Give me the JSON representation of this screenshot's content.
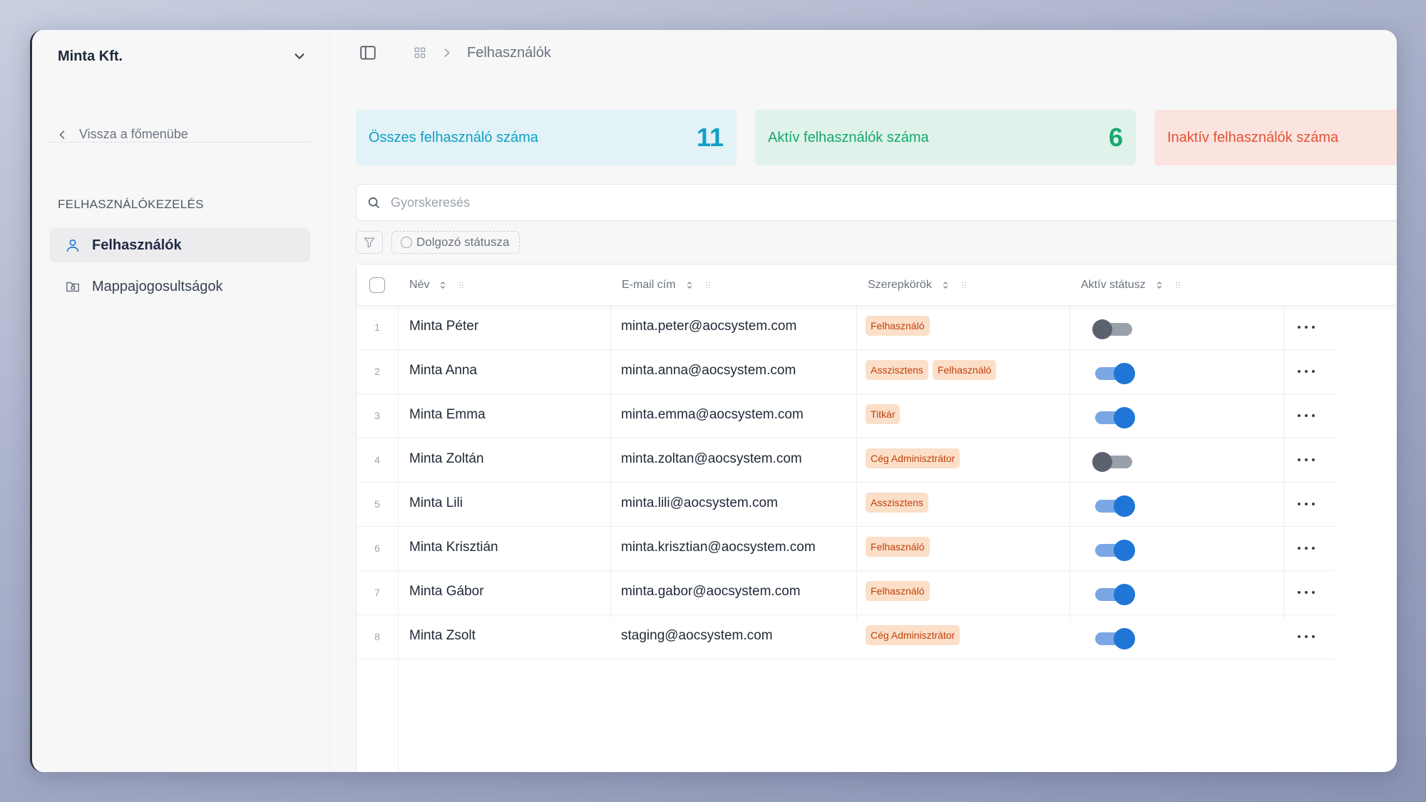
{
  "sidebar": {
    "org_name": "Minta Kft.",
    "back_label": "Vissza a főmenübe",
    "section_title": "FELHASZNÁLÓKEZELÉS",
    "items": [
      {
        "label": "Felhasználók",
        "icon": "user-icon",
        "active": true
      },
      {
        "label": "Mappajogosultságok",
        "icon": "folder-lock-icon",
        "active": false
      }
    ]
  },
  "breadcrumb": {
    "current": "Felhasználók"
  },
  "stats": [
    {
      "label": "Összes felhasználó száma",
      "value": "11",
      "color": "#0e9fc7",
      "bg": "#e2f2f6"
    },
    {
      "label": "Aktív felhasználók száma",
      "value": "6",
      "color": "#15a872",
      "bg": "#e0f2ea"
    },
    {
      "label": "Inaktív felhasználók száma",
      "value": "",
      "color": "#e25534",
      "bg": "#fbe3e0"
    }
  ],
  "search": {
    "placeholder": "Gyorskeresés"
  },
  "filters": {
    "status_label": "Dolgozó státusza"
  },
  "table": {
    "columns": {
      "name": "Név",
      "email": "E-mail cím",
      "roles": "Szerepkörök",
      "active": "Aktív státusz"
    },
    "rows": [
      {
        "idx": "1",
        "name": "Minta Péter",
        "email": "minta.peter@aocsystem.com",
        "roles": [
          "Felhasználó"
        ],
        "active": false
      },
      {
        "idx": "2",
        "name": "Minta Anna",
        "email": "minta.anna@aocsystem.com",
        "roles": [
          "Asszisztens",
          "Felhasználó"
        ],
        "active": true
      },
      {
        "idx": "3",
        "name": "Minta Emma",
        "email": "minta.emma@aocsystem.com",
        "roles": [
          "Titkár"
        ],
        "active": true
      },
      {
        "idx": "4",
        "name": "Minta Zoltán",
        "email": "minta.zoltan@aocsystem.com",
        "roles": [
          "Cég Adminisztrátor"
        ],
        "active": false
      },
      {
        "idx": "5",
        "name": "Minta Lili",
        "email": "minta.lili@aocsystem.com",
        "roles": [
          "Asszisztens"
        ],
        "active": true
      },
      {
        "idx": "6",
        "name": "Minta Krisztián",
        "email": "minta.krisztian@aocsystem.com",
        "roles": [
          "Felhasználó"
        ],
        "active": true
      },
      {
        "idx": "7",
        "name": "Minta Gábor",
        "email": "minta.gabor@aocsystem.com",
        "roles": [
          "Felhasználó"
        ],
        "active": true
      },
      {
        "idx": "8",
        "name": "Minta Zsolt",
        "email": "staging@aocsystem.com",
        "roles": [
          "Cég Adminisztrátor"
        ],
        "active": true
      }
    ]
  }
}
